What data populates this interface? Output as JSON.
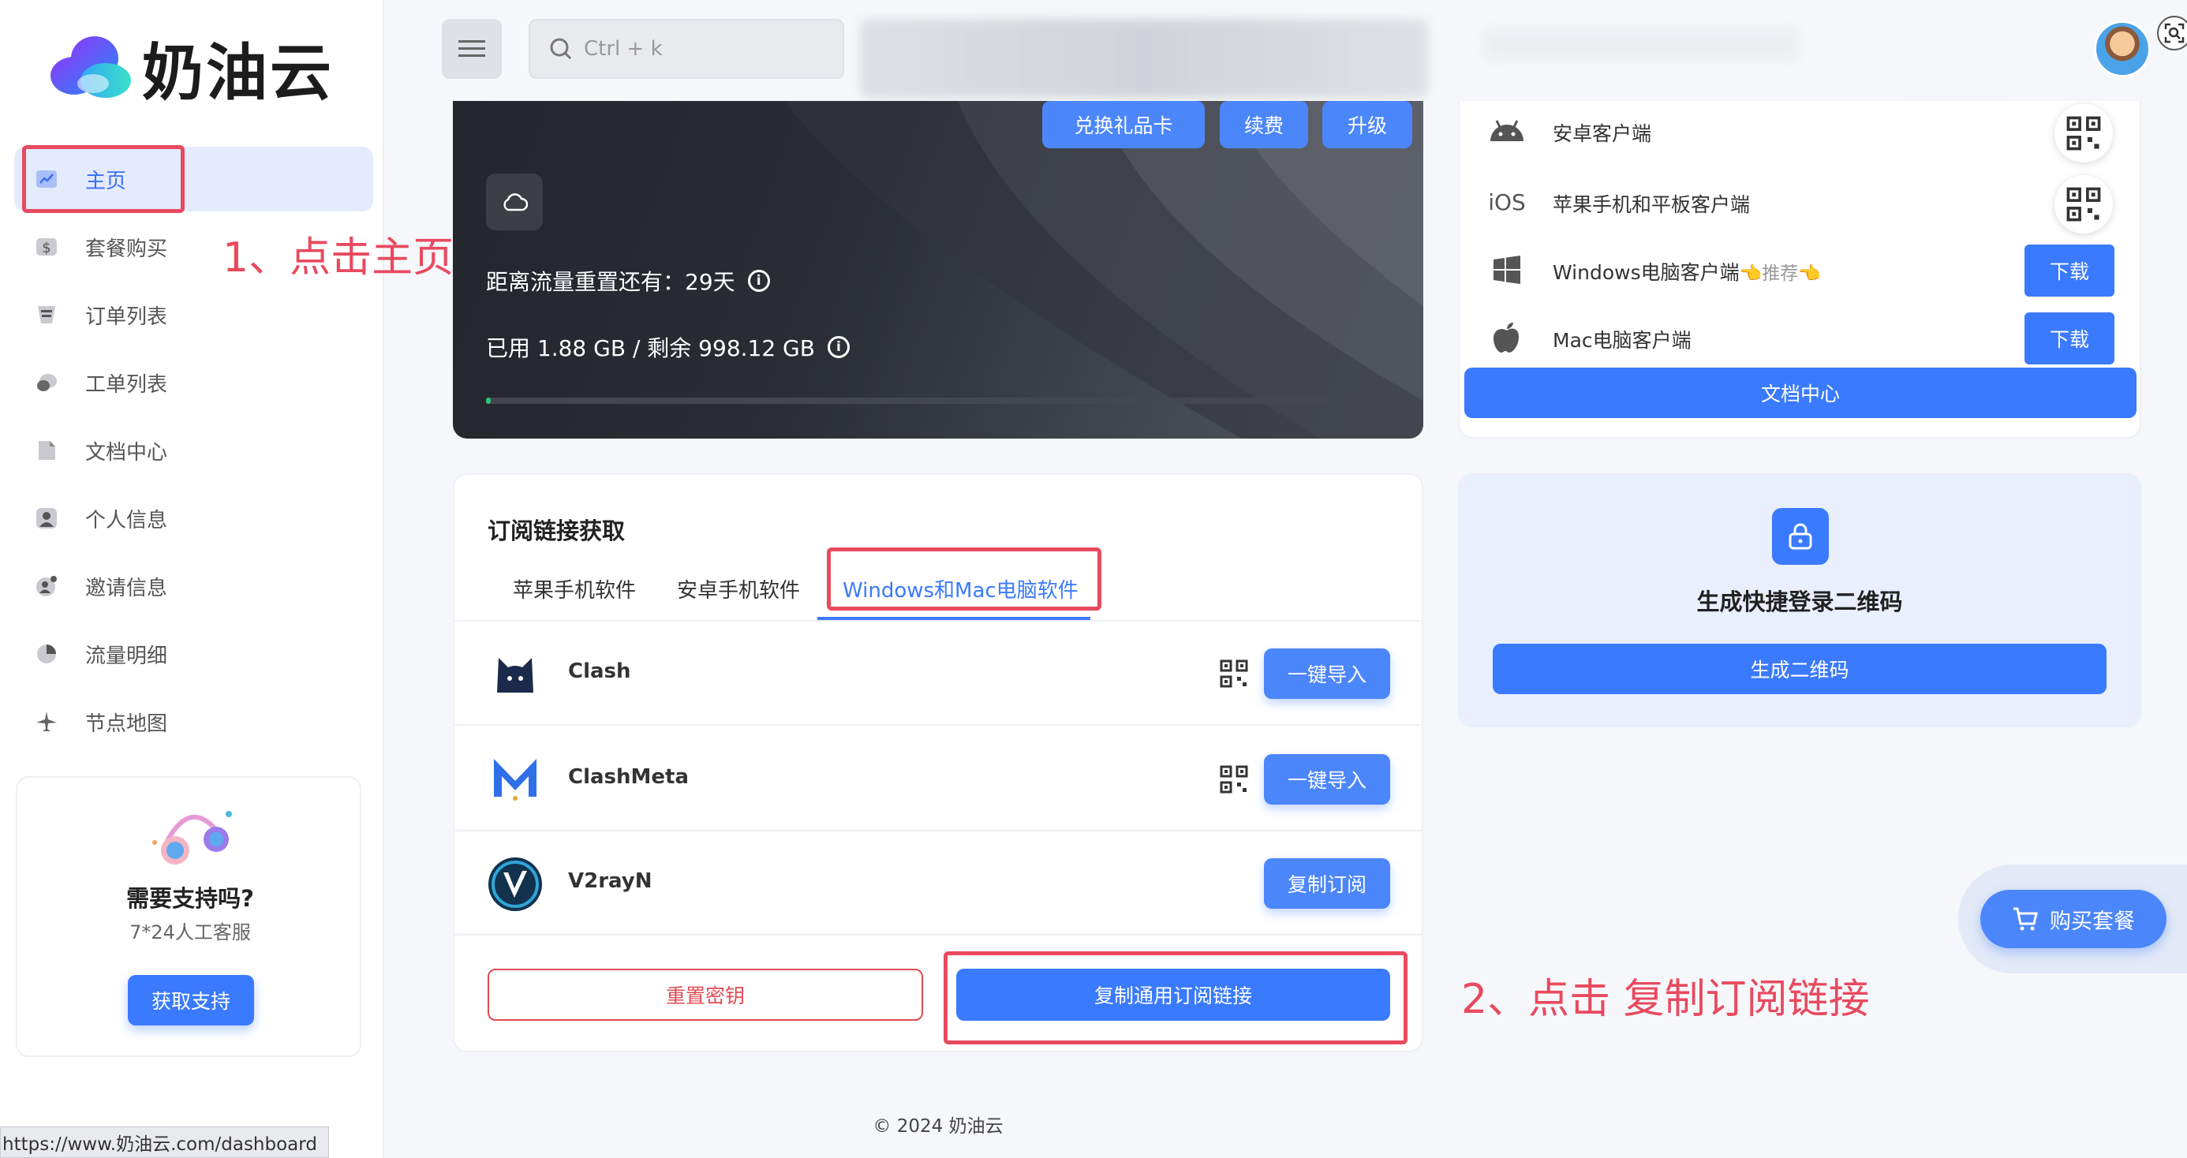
{
  "brand": {
    "name": "奶油云"
  },
  "sidebar": {
    "items": [
      {
        "label": "主页",
        "icon": "chart-icon"
      },
      {
        "label": "套餐购买",
        "icon": "dollar-icon"
      },
      {
        "label": "订单列表",
        "icon": "list-icon"
      },
      {
        "label": "工单列表",
        "icon": "chat-icon"
      },
      {
        "label": "文档中心",
        "icon": "document-icon"
      },
      {
        "label": "个人信息",
        "icon": "user-icon"
      },
      {
        "label": "邀请信息",
        "icon": "invite-icon"
      },
      {
        "label": "流量明细",
        "icon": "pie-icon"
      },
      {
        "label": "节点地图",
        "icon": "plane-icon"
      }
    ],
    "support": {
      "title": "需要支持吗?",
      "subtitle": "7*24人工客服",
      "button": "获取支持"
    }
  },
  "annotations": {
    "step1": "1、点击主页",
    "step2": "2、点击 复制订阅链接"
  },
  "search": {
    "placeholder": "Ctrl + k"
  },
  "traffic": {
    "buttons": [
      "兑换礼品卡",
      "续费",
      "升级"
    ],
    "reset_text": "距离流量重置还有：29天",
    "used_text": "已用 1.88 GB / 剩余 998.12 GB",
    "used_fraction": 0.0019,
    "progress_color": "#2ec27e"
  },
  "subscription": {
    "title": "订阅链接获取",
    "tabs": [
      "苹果手机软件",
      "安卓手机软件",
      "Windows和Mac电脑软件"
    ],
    "active_tab": 2,
    "clients": [
      {
        "name": "Clash",
        "action": "一键导入",
        "has_qr": true
      },
      {
        "name": "ClashMeta",
        "action": "一键导入",
        "has_qr": true
      },
      {
        "name": "V2rayN",
        "action": "复制订阅",
        "has_qr": false
      }
    ],
    "reset_key_button": "重置密钥",
    "copy_link_button": "复制通用订阅链接"
  },
  "apps": {
    "rows": [
      {
        "icon_text": "",
        "icon": "android-icon",
        "name": "安卓客户端",
        "recommend": "",
        "action": "qr"
      },
      {
        "icon_text": "iOS",
        "icon": "ios-icon",
        "name": "苹果手机和平板客户端",
        "recommend": "",
        "action": "qr"
      },
      {
        "icon_text": "",
        "icon": "windows-icon",
        "name": "Windows电脑客户端",
        "recommend": "👈推荐👈",
        "action": "下载"
      },
      {
        "icon_text": "",
        "icon": "apple-icon",
        "name": "Mac电脑客户端",
        "recommend": "",
        "action": "下载"
      }
    ],
    "docs_button": "文档中心"
  },
  "quick_login": {
    "title": "生成快捷登录二维码",
    "button": "生成二维码"
  },
  "buy_float": {
    "label": "购买套餐"
  },
  "footer": {
    "text": "© 2024 奶油云"
  },
  "status_bar": {
    "url": "https://www.奶油云.com/dashboard"
  },
  "colors": {
    "accent": "#3a7afe",
    "danger": "#e24b55",
    "annotation": "#e84a5f"
  }
}
